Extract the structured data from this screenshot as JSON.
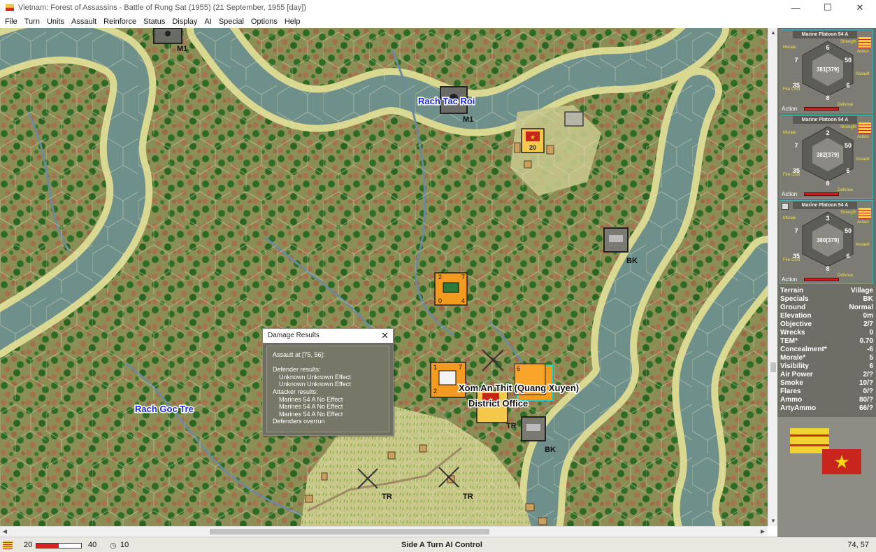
{
  "window": {
    "title": "Vietnam: Forest of Assassins - Battle of Rung Sat (1955) (21 September, 1955 [day])",
    "minimize": "—",
    "maximize": "☐",
    "close": "✕"
  },
  "menu": [
    "File",
    "Turn",
    "Units",
    "Assault",
    "Reinforce",
    "Status",
    "Display",
    "AI",
    "Special",
    "Options",
    "Help"
  ],
  "map": {
    "place_labels": [
      {
        "id": "rach-tac-roi",
        "text": "Rach Tac Roi"
      },
      {
        "id": "rach-goc-tre",
        "text": "Rach Goc Tre"
      },
      {
        "id": "xom-an-thit",
        "text": "Xom An Thit (Quang Xuyen)"
      },
      {
        "id": "district-office",
        "text": "District Office"
      }
    ],
    "unit_tags": [
      "M1",
      "M1",
      "BK",
      "BK",
      "TR",
      "TR",
      "TR"
    ],
    "counter_values": {
      "top_strength": "20",
      "orange1_top_left": "2",
      "orange1_top_right": "7",
      "orange1_bot_left": "0",
      "orange1_bot_right": "4",
      "orange2_top_left": "1",
      "orange2_top_right": "7",
      "orange2_bot_left": "2",
      "stack_top_left": "6"
    }
  },
  "dialog": {
    "title": "Damage Results",
    "close": "✕",
    "lines": [
      "Assault at [75, 56]:",
      "",
      "Defender results:",
      "Unknown Unknown Effect",
      "Unknown Unknown Effect",
      "Attacker results:",
      "Marines 54 A No Effect",
      "Marines 54 A No Effect",
      "Marines 54 A No Effect",
      "Defenders overrun"
    ]
  },
  "units": [
    {
      "name": "Marine Platoon 54 A",
      "strength": "6",
      "morale": "7",
      "assault": "50",
      "fire": "35",
      "defense": "8",
      "armor": "6",
      "id_text": "381[379]",
      "action_frac": 0.62,
      "labels": {
        "strength": "Strength",
        "morale": "Morale",
        "assault": "Assault",
        "fire": "Fire Cost",
        "defense": "Defense",
        "action": "Action"
      }
    },
    {
      "name": "Marine Platoon 54 A",
      "strength": "2",
      "morale": "7",
      "assault": "50",
      "fire": "35",
      "defense": "8",
      "armor": "6",
      "id_text": "382[379]",
      "action_frac": 0.62,
      "labels": {
        "strength": "Strength",
        "morale": "Morale",
        "assault": "Assault",
        "fire": "Fire Cost",
        "defense": "Defense",
        "action": "Action"
      }
    },
    {
      "name": "Marine Platoon 54 A",
      "strength": "3",
      "morale": "7",
      "assault": "50",
      "fire": "35",
      "defense": "8",
      "armor": "6",
      "id_text": "380[379]",
      "action_frac": 0.62,
      "labels": {
        "strength": "Strength",
        "morale": "Morale",
        "assault": "Assault",
        "fire": "Fire Cost",
        "defense": "Defense",
        "action": "Action"
      }
    }
  ],
  "unit_action_label": "Action",
  "terrain": [
    {
      "k": "Terrain",
      "v": "Village"
    },
    {
      "k": "Specials",
      "v": "BK"
    },
    {
      "k": "Ground",
      "v": "Normal"
    },
    {
      "k": "Elevation",
      "v": "0m"
    },
    {
      "k": "Objective",
      "v": "2/7"
    },
    {
      "k": "Wrecks",
      "v": "0"
    },
    {
      "k": "TEM*",
      "v": "0.70"
    },
    {
      "k": "Concealment*",
      "v": "-6"
    },
    {
      "k": "Morale*",
      "v": "5"
    },
    {
      "k": "Visibility",
      "v": "6"
    },
    {
      "k": "Air Power",
      "v": "2/?"
    },
    {
      "k": "Smoke",
      "v": "10/?"
    },
    {
      "k": "Flares",
      "v": "0/?"
    },
    {
      "k": "Ammo",
      "v": "80/?"
    },
    {
      "k": "ArtyAmmo",
      "v": "66/?"
    }
  ],
  "flags": {
    "dr_star": "★"
  },
  "status": {
    "value_left": "20",
    "value_right": "40",
    "bar_fill_frac": 0.5,
    "clock_icon": "◷",
    "turn_value": "10",
    "center_text": "Side A Turn AI Control",
    "coords": "74, 57"
  },
  "scroll": {
    "up": "▲",
    "down": "▼",
    "left": "◀",
    "right": "▶"
  }
}
